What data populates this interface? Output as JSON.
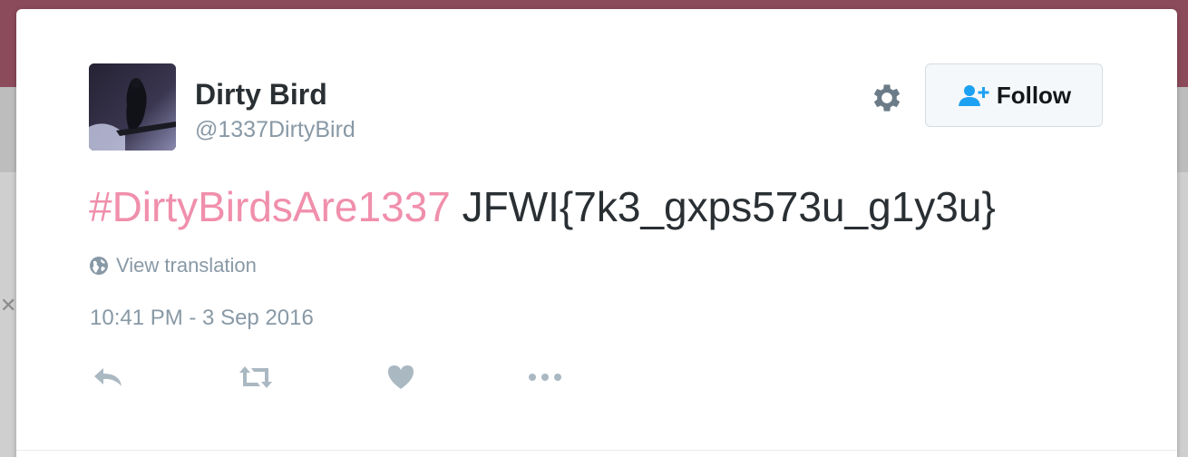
{
  "tweet": {
    "author_name": "Dirty Bird",
    "author_handle": "@1337DirtyBird",
    "hashtag": "#DirtyBirdsAre1337",
    "text": " JFWI{7k3_gxps573u_g1y3u}",
    "translation_link": "View translation",
    "timestamp": "10:41 PM - 3 Sep 2016"
  },
  "header": {
    "follow_label": "Follow",
    "settings_icon": "gear-icon",
    "follow_icon": "add-user-icon"
  },
  "actions": [
    {
      "icon": "reply-icon"
    },
    {
      "icon": "retweet-icon"
    },
    {
      "icon": "like-heart-icon"
    },
    {
      "icon": "more-dots-icon"
    }
  ],
  "colors": {
    "hashtag": "#f08fac",
    "muted_text": "#8899a6",
    "primary_text": "#292f33",
    "follow_icon": "#1da1f2",
    "backdrop_top": "#8c4b5a"
  }
}
